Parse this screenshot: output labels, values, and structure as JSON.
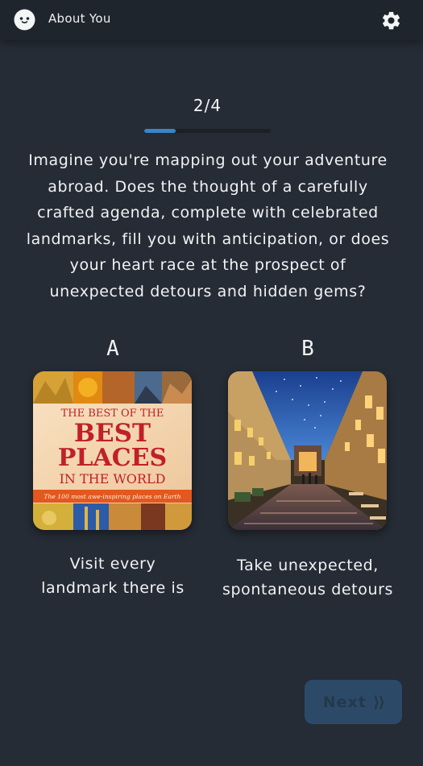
{
  "header": {
    "title": "About You",
    "logo_icon": "ghost-face-icon",
    "settings_icon": "gear-icon"
  },
  "progress": {
    "label": "2/4",
    "fraction": 0.25,
    "accent": "#3a85c6"
  },
  "question": {
    "text": "Imagine you're mapping out your  adventure abroad. Does the thought of a carefully crafted agenda, complete with celebrated landmarks, fill you with anticipation, or does your heart race at the prospect of unexpected detours and hidden gems?"
  },
  "options": [
    {
      "letter": "A",
      "image": "book-cover-best-places-image",
      "cover_lines": [
        "THE BEST OF THE",
        "BEST",
        "PLACES",
        "IN THE WORLD",
        "The 100 most awe-inspiring places on Earth"
      ],
      "label_line1": "Visit every",
      "label_line2": "landmark there is"
    },
    {
      "letter": "B",
      "image": "street-arcade-night-image",
      "label_line1": "Take unexpected,",
      "label_line2": "spontaneous detours"
    }
  ],
  "footer": {
    "next_label": "Next",
    "next_chevrons": "⟩⟩"
  }
}
